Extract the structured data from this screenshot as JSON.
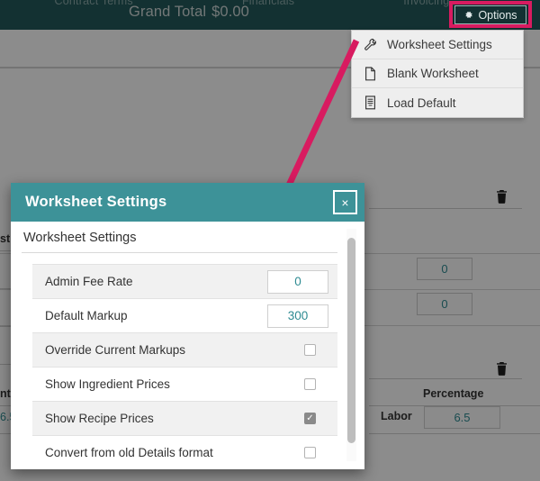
{
  "topbar": {
    "tabs": [
      "Contract Terms",
      "Financials",
      "Invoicing"
    ],
    "grand_total_label": "Grand Total",
    "grand_total_value": "$0.00",
    "options_label": "Options",
    "options_icon": "gear-icon",
    "bar_color": "#245a5b",
    "highlight_color": "#d81b60"
  },
  "menu": {
    "items": [
      {
        "label": "Worksheet Settings",
        "icon": "wrench-icon"
      },
      {
        "label": "Blank Worksheet",
        "icon": "document-icon"
      },
      {
        "label": "Load Default",
        "icon": "list-document-icon"
      }
    ]
  },
  "modal": {
    "title": "Worksheet Settings",
    "close_label": "×",
    "section_title": "Worksheet Settings",
    "accent_color": "#3d9298",
    "value_color": "#2e8b92",
    "settings": [
      {
        "label": "Admin Fee Rate",
        "type": "input",
        "value": "0",
        "striped": true
      },
      {
        "label": "Default Markup",
        "type": "input",
        "value": "300",
        "striped": false
      },
      {
        "label": "Override Current Markups",
        "type": "checkbox",
        "checked": false,
        "striped": true
      },
      {
        "label": "Show Ingredient Prices",
        "type": "checkbox",
        "checked": false,
        "striped": false
      },
      {
        "label": "Show Recipe Prices",
        "type": "checkbox",
        "checked": true,
        "striped": true
      },
      {
        "label": "Convert from old Details format",
        "type": "checkbox",
        "checked": false,
        "striped": false
      }
    ]
  },
  "background": {
    "inputs": [
      "0",
      "0"
    ],
    "percentage_header": "Percentage",
    "labor_label": "Labor",
    "labor_value": "6.5",
    "left_fragments": [
      "st",
      "nt",
      "6.5"
    ],
    "trash_icon": "trash-icon"
  }
}
